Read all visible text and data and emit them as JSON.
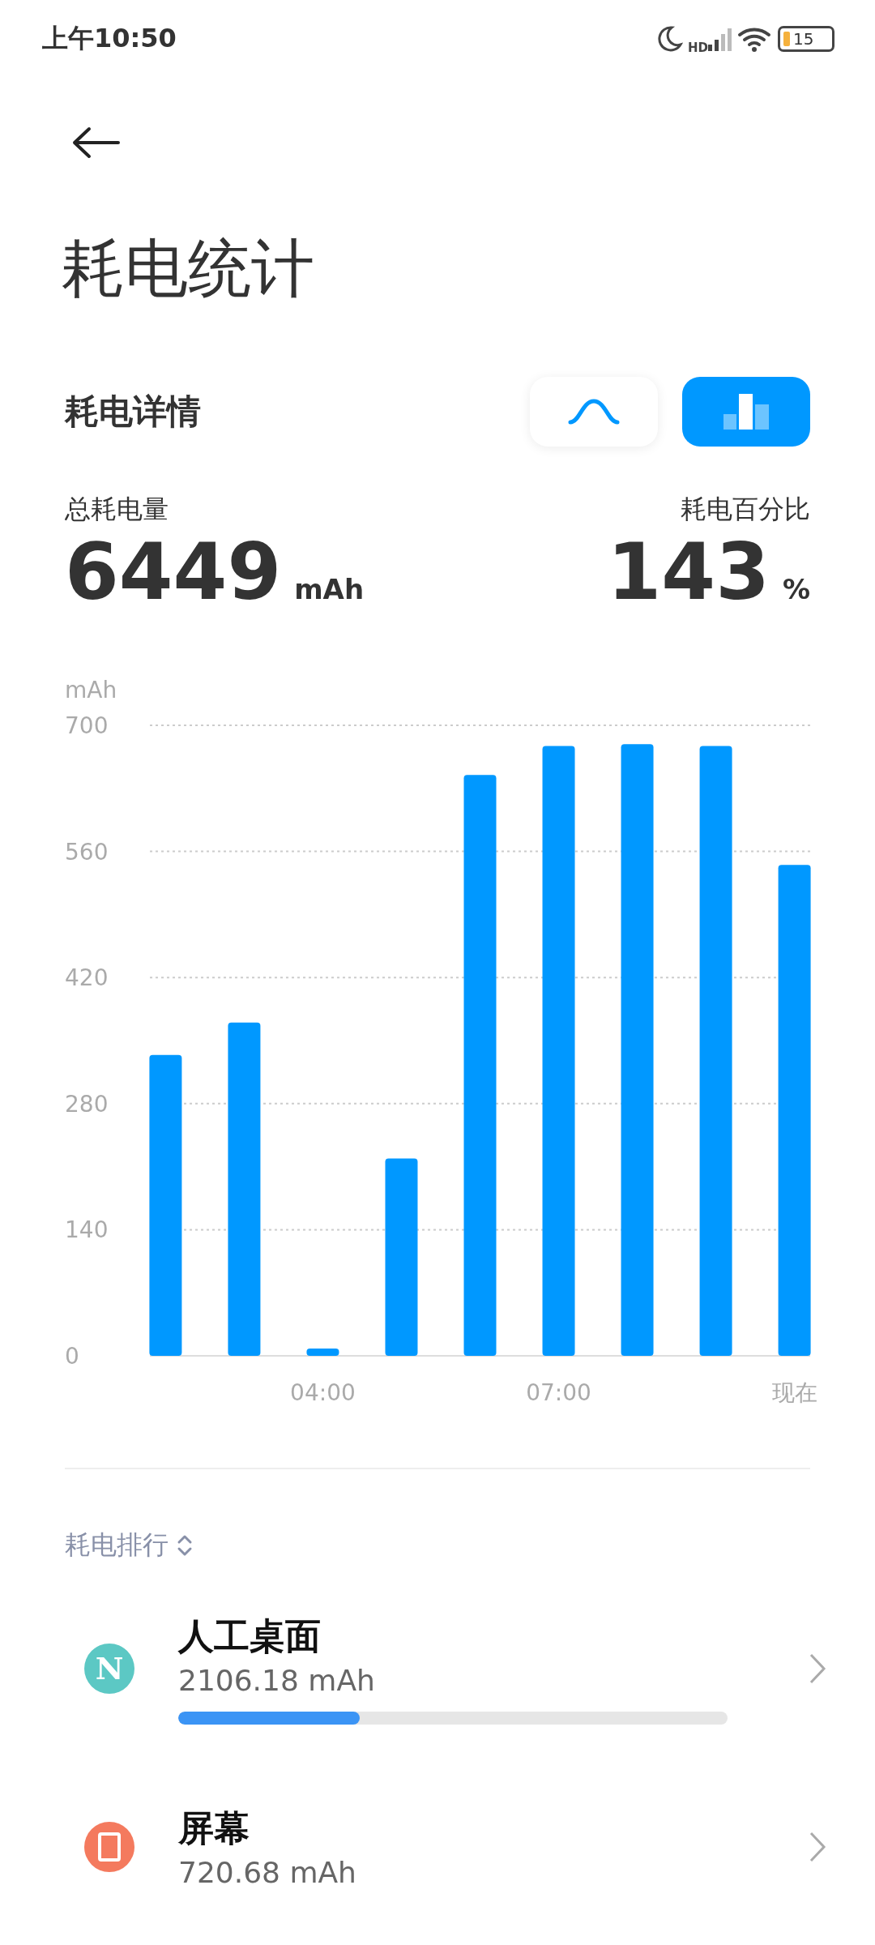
{
  "status_bar": {
    "time": "上午10:50",
    "network": "HD",
    "battery": "15"
  },
  "header": {
    "title": "耗电统计"
  },
  "details": {
    "title": "耗电详情",
    "view_toggles": [
      {
        "kind": "curve",
        "selected": false
      },
      {
        "kind": "bars",
        "selected": true
      }
    ],
    "total_label": "总耗电量",
    "total_value": "6449",
    "total_unit": "mAh",
    "percent_label": "耗电百分比",
    "percent_value": "143",
    "percent_unit": "%",
    "chart_data": {
      "type": "bar",
      "ylabel": "mAh",
      "x": [
        2,
        3,
        4,
        5,
        6,
        7,
        8,
        9,
        10
      ],
      "series": [
        {
          "color": "#0098ff",
          "values": [
            334,
            370,
            8,
            219,
            645,
            677,
            679,
            677,
            545
          ]
        }
      ],
      "grid": true,
      "xlim": [
        1.8,
        10.2
      ],
      "ylim": [
        0,
        700
      ],
      "yticks": [
        {
          "value": 0,
          "label": "0"
        },
        {
          "value": 140,
          "label": "140"
        },
        {
          "value": 280,
          "label": "280"
        },
        {
          "value": 420,
          "label": "420"
        },
        {
          "value": 560,
          "label": "560"
        },
        {
          "value": 700,
          "label": "700"
        }
      ],
      "xticks": [
        {
          "value": 4,
          "label": "04:00"
        },
        {
          "value": 7,
          "label": "07:00"
        },
        {
          "value": 10,
          "label": "现在"
        }
      ]
    }
  },
  "ranking": {
    "sort_label": "耗电排行",
    "items": [
      {
        "kind": "letter",
        "icon_text": "N",
        "color": "#5cc8c4",
        "name": "人工桌面",
        "usage": "2106.18 mAh",
        "level": 0.33
      },
      {
        "kind": "phone",
        "color": "#f47a5e",
        "name": "屏幕",
        "usage": "720.68 mAh"
      }
    ]
  }
}
